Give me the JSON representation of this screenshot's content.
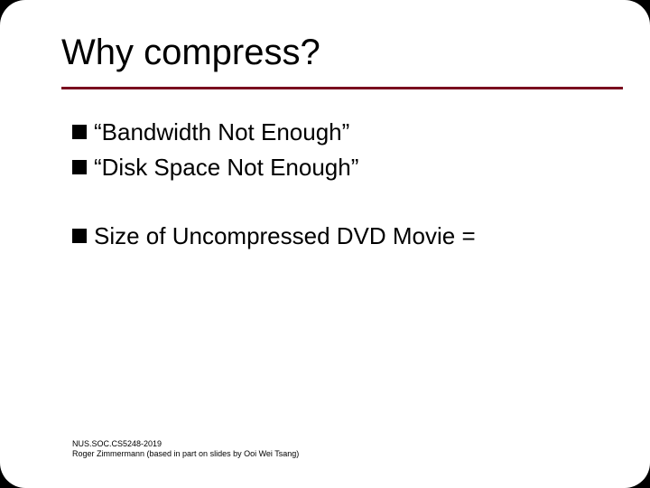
{
  "title": "Why compress?",
  "bullets": {
    "b1": "“Bandwidth Not Enough”",
    "b2": "“Disk Space Not Enough”",
    "b3": "Size of Uncompressed DVD Movie ="
  },
  "footer": {
    "line1": "NUS.SOC.CS5248-2019",
    "line2": "Roger Zimmermann (based in part on slides by Ooi Wei Tsang)"
  }
}
